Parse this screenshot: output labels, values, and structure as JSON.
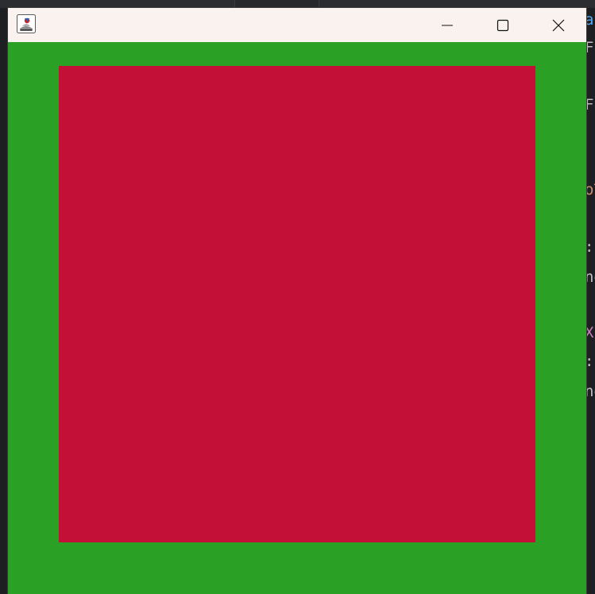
{
  "window": {
    "title": "",
    "controls": {
      "minimize": "minimize",
      "maximize": "maximize",
      "close": "close"
    }
  },
  "canvas": {
    "background_color": "#2aa024",
    "square_color": "#c21037"
  },
  "background_code_fragments": [
    {
      "text": "ar",
      "color": "#56a8f5"
    },
    {
      "text": "F",
      "color": "#bcbec4"
    },
    {
      "text": "F",
      "color": "#bcbec4"
    },
    {
      "text": "oT",
      "color": "#cf8e6d"
    },
    {
      "text": ": ",
      "color": "#bcbec4"
    },
    {
      "text": "nd",
      "color": "#bcbec4"
    },
    {
      "text": "X]",
      "color": "#c77dbb"
    },
    {
      "text": ": ",
      "color": "#bcbec4"
    },
    {
      "text": "nd",
      "color": "#bcbec4"
    }
  ]
}
